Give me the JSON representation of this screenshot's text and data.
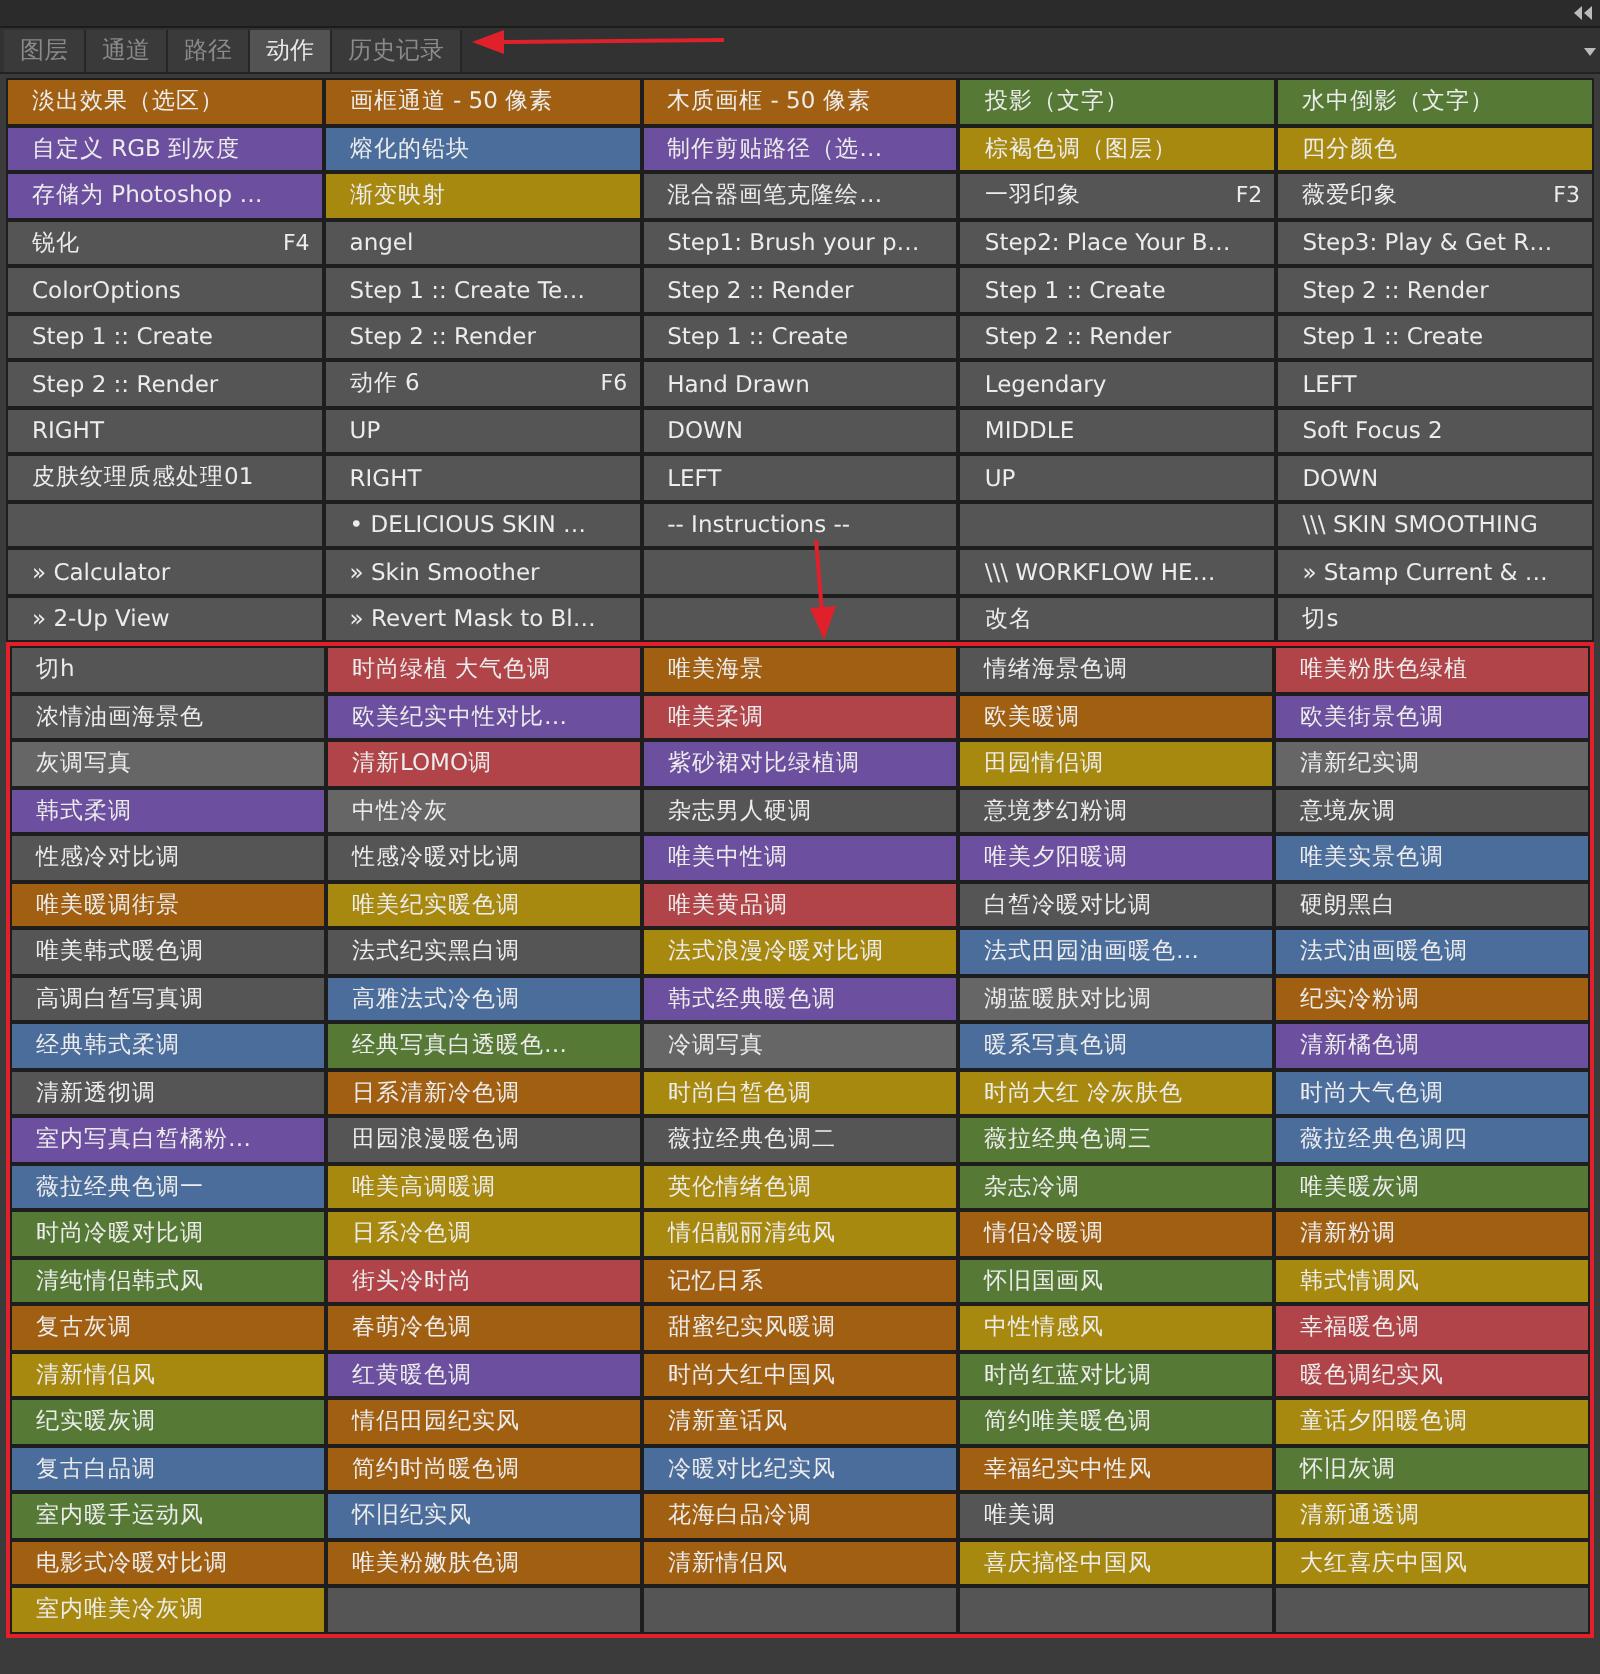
{
  "tabs": [
    {
      "label": "图层",
      "selected": false
    },
    {
      "label": "通道",
      "selected": false
    },
    {
      "label": "路径",
      "selected": false
    },
    {
      "label": "动作",
      "selected": true
    },
    {
      "label": "历史记录",
      "selected": false
    }
  ],
  "button_rows": [
    [
      {
        "label": "淡出效果（选区）",
        "color": "#a15f12"
      },
      {
        "label": "画框通道 - 50 像素",
        "color": "#a15f12"
      },
      {
        "label": "木质画框 - 50 像素",
        "color": "#a15f12"
      },
      {
        "label": "投影（文字）",
        "color": "#567a35"
      },
      {
        "label": "水中倒影（文字）",
        "color": "#567a35"
      }
    ],
    [
      {
        "label": "自定义 RGB 到灰度",
        "color": "#6c4f9e"
      },
      {
        "label": "熔化的铅块",
        "color": "#4b6d9c"
      },
      {
        "label": "制作剪贴路径（选…",
        "color": "#6c4f9e"
      },
      {
        "label": "棕褐色调（图层）",
        "color": "#a8890f"
      },
      {
        "label": "四分颜色",
        "color": "#a8890f"
      }
    ],
    [
      {
        "label": "存储为 Photoshop …",
        "color": "#6c4f9e"
      },
      {
        "label": "渐变映射",
        "color": "#a8890f"
      },
      {
        "label": "混合器画笔克隆绘…",
        "color": "#555555"
      },
      {
        "label": "一羽印象",
        "shortcut": "F2",
        "color": "#555555"
      },
      {
        "label": "薇爱印象",
        "shortcut": "F3",
        "color": "#555555"
      }
    ],
    [
      {
        "label": "锐化",
        "shortcut": "F4",
        "color": "#555555"
      },
      {
        "label": "angel",
        "color": "#555555"
      },
      {
        "label": "Step1: Brush your p…",
        "color": "#555555"
      },
      {
        "label": "Step2: Place Your B…",
        "color": "#555555"
      },
      {
        "label": "Step3: Play & Get R…",
        "color": "#555555"
      }
    ],
    [
      {
        "label": "ColorOptions",
        "color": "#555555"
      },
      {
        "label": "Step 1 :: Create Te…",
        "color": "#555555"
      },
      {
        "label": "Step 2 :: Render",
        "color": "#555555"
      },
      {
        "label": "Step 1 :: Create",
        "color": "#555555"
      },
      {
        "label": "Step 2 :: Render",
        "color": "#555555"
      }
    ],
    [
      {
        "label": "Step 1 :: Create",
        "color": "#555555"
      },
      {
        "label": "Step 2 :: Render",
        "color": "#555555"
      },
      {
        "label": "Step 1 :: Create",
        "color": "#555555"
      },
      {
        "label": "Step 2 :: Render",
        "color": "#555555"
      },
      {
        "label": "Step 1 :: Create",
        "color": "#555555"
      }
    ],
    [
      {
        "label": "Step 2 :: Render",
        "color": "#555555"
      },
      {
        "label": "动作 6",
        "shortcut": "F6",
        "color": "#555555"
      },
      {
        "label": "Hand Drawn",
        "color": "#555555"
      },
      {
        "label": "Legendary",
        "color": "#555555"
      },
      {
        "label": "LEFT",
        "color": "#555555"
      }
    ],
    [
      {
        "label": "RIGHT",
        "color": "#555555"
      },
      {
        "label": "UP",
        "color": "#555555"
      },
      {
        "label": "DOWN",
        "color": "#555555"
      },
      {
        "label": "MIDDLE",
        "color": "#555555"
      },
      {
        "label": "Soft Focus 2",
        "color": "#555555"
      }
    ],
    [
      {
        "label": "皮肤纹理质感处理01",
        "color": "#555555"
      },
      {
        "label": "RIGHT",
        "color": "#555555"
      },
      {
        "label": "LEFT",
        "color": "#555555"
      },
      {
        "label": "UP",
        "color": "#555555"
      },
      {
        "label": "DOWN",
        "color": "#555555"
      }
    ],
    [
      {
        "color": "#555555"
      },
      {
        "label": "• DELICIOUS SKIN …",
        "color": "#555555"
      },
      {
        "label": "-- Instructions --",
        "color": "#555555"
      },
      {
        "color": "#555555"
      },
      {
        "label": "\\\\\\ SKIN SMOOTHING",
        "color": "#555555"
      }
    ],
    [
      {
        "label": "» Calculator",
        "color": "#555555"
      },
      {
        "label": "» Skin Smoother",
        "color": "#555555"
      },
      {
        "color": "#555555"
      },
      {
        "label": "\\\\\\ WORKFLOW HE…",
        "color": "#555555"
      },
      {
        "label": "» Stamp Current & …",
        "color": "#555555"
      }
    ],
    [
      {
        "label": "» 2-Up View",
        "color": "#555555"
      },
      {
        "label": "» Revert Mask to Bl…",
        "color": "#555555"
      },
      {
        "color": "#555555"
      },
      {
        "label": "改名",
        "color": "#555555"
      },
      {
        "label": "切s",
        "color": "#555555"
      }
    ]
  ],
  "framed_button_rows": [
    [
      {
        "label": "切h",
        "color": "#555555"
      },
      {
        "label": "时尚绿植 大气色调",
        "color": "#b04448"
      },
      {
        "label": "唯美海景",
        "color": "#a15f12"
      },
      {
        "label": "情绪海景色调",
        "color": "#555555"
      },
      {
        "label": "唯美粉肤色绿植",
        "color": "#b04448"
      }
    ],
    [
      {
        "label": "浓情油画海景色",
        "color": "#555555"
      },
      {
        "label": "欧美纪实中性对比…",
        "color": "#6c4f9e"
      },
      {
        "label": "唯美柔调",
        "color": "#b04448"
      },
      {
        "label": "欧美暖调",
        "color": "#a15f12"
      },
      {
        "label": "欧美街景色调",
        "color": "#6c4f9e"
      }
    ],
    [
      {
        "label": "灰调写真",
        "color": "#666666"
      },
      {
        "label": "清新LOMO调",
        "color": "#b04448"
      },
      {
        "label": "紫砂裙对比绿植调",
        "color": "#6c4f9e"
      },
      {
        "label": "田园情侣调",
        "color": "#a8890f"
      },
      {
        "label": "清新纪实调",
        "color": "#666666"
      }
    ],
    [
      {
        "label": "韩式柔调",
        "color": "#6c4f9e"
      },
      {
        "label": "中性冷灰",
        "color": "#666666"
      },
      {
        "label": "杂志男人硬调",
        "color": "#555555"
      },
      {
        "label": "意境梦幻粉调",
        "color": "#555555"
      },
      {
        "label": "意境灰调",
        "color": "#555555"
      }
    ],
    [
      {
        "label": "性感冷对比调",
        "color": "#555555"
      },
      {
        "label": "性感冷暖对比调",
        "color": "#555555"
      },
      {
        "label": "唯美中性调",
        "color": "#6c4f9e"
      },
      {
        "label": "唯美夕阳暖调",
        "color": "#6c4f9e"
      },
      {
        "label": "唯美实景色调",
        "color": "#4b6d9c"
      }
    ],
    [
      {
        "label": "唯美暖调街景",
        "color": "#a15f12"
      },
      {
        "label": "唯美纪实暖色调",
        "color": "#a8890f"
      },
      {
        "label": "唯美黄品调",
        "color": "#b04448"
      },
      {
        "label": "白皙冷暖对比调",
        "color": "#555555"
      },
      {
        "label": "硬朗黑白",
        "color": "#555555"
      }
    ],
    [
      {
        "label": "唯美韩式暖色调",
        "color": "#555555"
      },
      {
        "label": "法式纪实黑白调",
        "color": "#555555"
      },
      {
        "label": "法式浪漫冷暖对比调",
        "color": "#a8890f"
      },
      {
        "label": "法式田园油画暖色…",
        "color": "#4b6d9c"
      },
      {
        "label": "法式油画暖色调",
        "color": "#4b6d9c"
      }
    ],
    [
      {
        "label": "高调白皙写真调",
        "color": "#555555"
      },
      {
        "label": "高雅法式冷色调",
        "color": "#4b6d9c"
      },
      {
        "label": "韩式经典暖色调",
        "color": "#6c4f9e"
      },
      {
        "label": "湖蓝暖肤对比调",
        "color": "#666666"
      },
      {
        "label": "纪实冷粉调",
        "color": "#a15f12"
      }
    ],
    [
      {
        "label": "经典韩式柔调",
        "color": "#4b6d9c"
      },
      {
        "label": "经典写真白透暖色…",
        "color": "#567a35"
      },
      {
        "label": "冷调写真",
        "color": "#666666"
      },
      {
        "label": "暖系写真色调",
        "color": "#4b6d9c"
      },
      {
        "label": "清新橘色调",
        "color": "#6c4f9e"
      }
    ],
    [
      {
        "label": "清新透彻调",
        "color": "#555555"
      },
      {
        "label": "日系清新冷色调",
        "color": "#a15f12"
      },
      {
        "label": "时尚白皙色调",
        "color": "#a8890f"
      },
      {
        "label": "时尚大红 冷灰肤色",
        "color": "#a8890f"
      },
      {
        "label": "时尚大气色调",
        "color": "#4b6d9c"
      }
    ],
    [
      {
        "label": "室内写真白皙橘粉…",
        "color": "#6c4f9e"
      },
      {
        "label": "田园浪漫暖色调",
        "color": "#555555"
      },
      {
        "label": "薇拉经典色调二",
        "color": "#555555"
      },
      {
        "label": "薇拉经典色调三",
        "color": "#567a35"
      },
      {
        "label": "薇拉经典色调四",
        "color": "#4b6d9c"
      }
    ],
    [
      {
        "label": "薇拉经典色调一",
        "color": "#4b6d9c"
      },
      {
        "label": "唯美高调暖调",
        "color": "#a8890f"
      },
      {
        "label": "英伦情绪色调",
        "color": "#a8890f"
      },
      {
        "label": "杂志冷调",
        "color": "#567a35"
      },
      {
        "label": "唯美暖灰调",
        "color": "#567a35"
      }
    ],
    [
      {
        "label": "时尚冷暖对比调",
        "color": "#567a35"
      },
      {
        "label": "日系冷色调",
        "color": "#a8890f"
      },
      {
        "label": "情侣靓丽清纯风",
        "color": "#a8890f"
      },
      {
        "label": "情侣冷暖调",
        "color": "#a15f12"
      },
      {
        "label": "清新粉调",
        "color": "#a15f12"
      }
    ],
    [
      {
        "label": "清纯情侣韩式风",
        "color": "#567a35"
      },
      {
        "label": "街头冷时尚",
        "color": "#b04448"
      },
      {
        "label": "记忆日系",
        "color": "#a15f12"
      },
      {
        "label": "怀旧国画风",
        "color": "#567a35"
      },
      {
        "label": "韩式情调风",
        "color": "#a8890f"
      }
    ],
    [
      {
        "label": "复古灰调",
        "color": "#a15f12"
      },
      {
        "label": "春萌冷色调",
        "color": "#a15f12"
      },
      {
        "label": "甜蜜纪实风暖调",
        "color": "#a15f12"
      },
      {
        "label": "中性情感风",
        "color": "#a8890f"
      },
      {
        "label": "幸福暖色调",
        "color": "#b04448"
      }
    ],
    [
      {
        "label": "清新情侣风",
        "color": "#a8890f"
      },
      {
        "label": "红黄暖色调",
        "color": "#6c4f9e"
      },
      {
        "label": "时尚大红中国风",
        "color": "#a15f12"
      },
      {
        "label": "时尚红蓝对比调",
        "color": "#567a35"
      },
      {
        "label": "暖色调纪实风",
        "color": "#b04448"
      }
    ],
    [
      {
        "label": "纪实暖灰调",
        "color": "#567a35"
      },
      {
        "label": "情侣田园纪实风",
        "color": "#a15f12"
      },
      {
        "label": "清新童话风",
        "color": "#a15f12"
      },
      {
        "label": "简约唯美暖色调",
        "color": "#567a35"
      },
      {
        "label": "童话夕阳暖色调",
        "color": "#a8890f"
      }
    ],
    [
      {
        "label": "复古白品调",
        "color": "#4b6d9c"
      },
      {
        "label": "简约时尚暖色调",
        "color": "#a15f12"
      },
      {
        "label": "冷暖对比纪实风",
        "color": "#4b6d9c"
      },
      {
        "label": "幸福纪实中性风",
        "color": "#a15f12"
      },
      {
        "label": "怀旧灰调",
        "color": "#567a35"
      }
    ],
    [
      {
        "label": "室内暖手运动风",
        "color": "#567a35"
      },
      {
        "label": "怀旧纪实风",
        "color": "#4b6d9c"
      },
      {
        "label": "花海白品冷调",
        "color": "#a15f12"
      },
      {
        "label": "唯美调",
        "color": "#555555"
      },
      {
        "label": "清新通透调",
        "color": "#a8890f"
      }
    ],
    [
      {
        "label": "电影式冷暖对比调",
        "color": "#a15f12"
      },
      {
        "label": "唯美粉嫩肤色调",
        "color": "#a15f12"
      },
      {
        "label": "清新情侣风",
        "color": "#a15f12"
      },
      {
        "label": "喜庆搞怪中国风",
        "color": "#a8890f"
      },
      {
        "label": "大红喜庆中国风",
        "color": "#a8890f"
      }
    ],
    [
      {
        "label": "室内唯美冷灰调",
        "color": "#a8890f"
      },
      {
        "color": "#555555"
      },
      {
        "color": "#555555"
      },
      {
        "color": "#555555"
      },
      {
        "color": "#555555"
      }
    ]
  ]
}
